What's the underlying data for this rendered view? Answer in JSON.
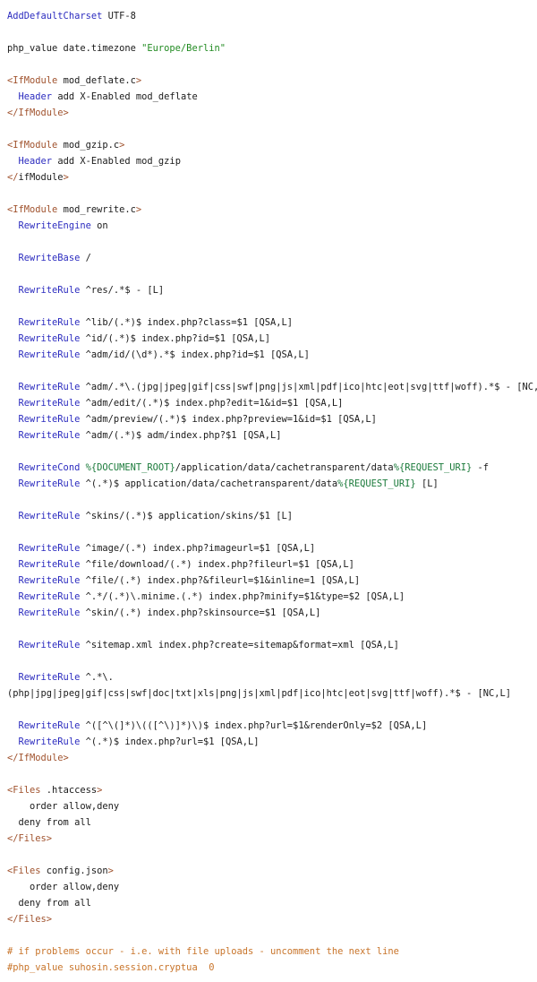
{
  "colors": {
    "keyword": "#2b2bbf",
    "string": "#228b22",
    "tag": "#a0522d",
    "variable": "#1a7a3a",
    "comment": "#c8742a",
    "text": "#1a1a1a",
    "background": "#ffffff"
  },
  "lines": [
    [
      {
        "t": "k",
        "v": "AddDefaultCharset"
      },
      {
        "t": "p",
        "v": " UTF-8"
      }
    ],
    [],
    [
      {
        "t": "p",
        "v": "php_value date.timezone "
      },
      {
        "t": "s",
        "v": "\"Europe/Berlin\""
      }
    ],
    [],
    [
      {
        "t": "t",
        "v": "<IfModule"
      },
      {
        "t": "p",
        "v": " mod_deflate.c"
      },
      {
        "t": "t",
        "v": ">"
      }
    ],
    [
      {
        "t": "p",
        "v": "  "
      },
      {
        "t": "k",
        "v": "Header"
      },
      {
        "t": "p",
        "v": " add X-Enabled mod_deflate"
      }
    ],
    [
      {
        "t": "t",
        "v": "</IfModule>"
      }
    ],
    [],
    [
      {
        "t": "t",
        "v": "<IfModule"
      },
      {
        "t": "p",
        "v": " mod_gzip.c"
      },
      {
        "t": "t",
        "v": ">"
      }
    ],
    [
      {
        "t": "p",
        "v": "  "
      },
      {
        "t": "k",
        "v": "Header"
      },
      {
        "t": "p",
        "v": " add X-Enabled mod_gzip"
      }
    ],
    [
      {
        "t": "t",
        "v": "</"
      },
      {
        "t": "p",
        "v": "ifModule"
      },
      {
        "t": "t",
        "v": ">"
      }
    ],
    [],
    [
      {
        "t": "t",
        "v": "<IfModule"
      },
      {
        "t": "p",
        "v": " mod_rewrite.c"
      },
      {
        "t": "t",
        "v": ">"
      }
    ],
    [
      {
        "t": "p",
        "v": "  "
      },
      {
        "t": "k",
        "v": "RewriteEngine"
      },
      {
        "t": "p",
        "v": " on"
      }
    ],
    [],
    [
      {
        "t": "p",
        "v": "  "
      },
      {
        "t": "k",
        "v": "RewriteBase"
      },
      {
        "t": "p",
        "v": " /"
      }
    ],
    [],
    [
      {
        "t": "p",
        "v": "  "
      },
      {
        "t": "k",
        "v": "RewriteRule"
      },
      {
        "t": "p",
        "v": " ^res/.*$ - [L]"
      }
    ],
    [],
    [
      {
        "t": "p",
        "v": "  "
      },
      {
        "t": "k",
        "v": "RewriteRule"
      },
      {
        "t": "p",
        "v": " ^lib/(.*)$ index.php?class=$1 [QSA,L]"
      }
    ],
    [
      {
        "t": "p",
        "v": "  "
      },
      {
        "t": "k",
        "v": "RewriteRule"
      },
      {
        "t": "p",
        "v": " ^id/(.*)$ index.php?id=$1 [QSA,L]"
      }
    ],
    [
      {
        "t": "p",
        "v": "  "
      },
      {
        "t": "k",
        "v": "RewriteRule"
      },
      {
        "t": "p",
        "v": " ^adm/id/(\\d*).*$ index.php?id=$1 [QSA,L]"
      }
    ],
    [],
    [
      {
        "t": "p",
        "v": "  "
      },
      {
        "t": "k",
        "v": "RewriteRule"
      },
      {
        "t": "p",
        "v": " ^adm/.*\\.(jpg|jpeg|gif|css|swf|png|js|xml|pdf|ico|htc|eot|svg|ttf|woff).*$ - [NC,L]"
      }
    ],
    [
      {
        "t": "p",
        "v": "  "
      },
      {
        "t": "k",
        "v": "RewriteRule"
      },
      {
        "t": "p",
        "v": " ^adm/edit/(.*)$ index.php?edit=1&id=$1 [QSA,L]"
      }
    ],
    [
      {
        "t": "p",
        "v": "  "
      },
      {
        "t": "k",
        "v": "RewriteRule"
      },
      {
        "t": "p",
        "v": " ^adm/preview/(.*)$ index.php?preview=1&id=$1 [QSA,L]"
      }
    ],
    [
      {
        "t": "p",
        "v": "  "
      },
      {
        "t": "k",
        "v": "RewriteRule"
      },
      {
        "t": "p",
        "v": " ^adm/(.*)$ adm/index.php?$1 [QSA,L]"
      }
    ],
    [],
    [
      {
        "t": "p",
        "v": "  "
      },
      {
        "t": "k",
        "v": "RewriteCond"
      },
      {
        "t": "p",
        "v": " "
      },
      {
        "t": "v",
        "v": "%{DOCUMENT_ROOT}"
      },
      {
        "t": "p",
        "v": "/application/data/cachetransparent/data"
      },
      {
        "t": "v",
        "v": "%{REQUEST_URI}"
      },
      {
        "t": "p",
        "v": " -f"
      }
    ],
    [
      {
        "t": "p",
        "v": "  "
      },
      {
        "t": "k",
        "v": "RewriteRule"
      },
      {
        "t": "p",
        "v": " ^(.*)$ application/data/cachetransparent/data"
      },
      {
        "t": "v",
        "v": "%{REQUEST_URI}"
      },
      {
        "t": "p",
        "v": " [L]"
      }
    ],
    [],
    [
      {
        "t": "p",
        "v": "  "
      },
      {
        "t": "k",
        "v": "RewriteRule"
      },
      {
        "t": "p",
        "v": " ^skins/(.*)$ application/skins/$1 [L]"
      }
    ],
    [],
    [
      {
        "t": "p",
        "v": "  "
      },
      {
        "t": "k",
        "v": "RewriteRule"
      },
      {
        "t": "p",
        "v": " ^image/(.*) index.php?imageurl=$1 [QSA,L]"
      }
    ],
    [
      {
        "t": "p",
        "v": "  "
      },
      {
        "t": "k",
        "v": "RewriteRule"
      },
      {
        "t": "p",
        "v": " ^file/download/(.*) index.php?fileurl=$1 [QSA,L]"
      }
    ],
    [
      {
        "t": "p",
        "v": "  "
      },
      {
        "t": "k",
        "v": "RewriteRule"
      },
      {
        "t": "p",
        "v": " ^file/(.*) index.php?&fileurl=$1&inline=1 [QSA,L]"
      }
    ],
    [
      {
        "t": "p",
        "v": "  "
      },
      {
        "t": "k",
        "v": "RewriteRule"
      },
      {
        "t": "p",
        "v": " ^.*/(.*)\\.minime.(.*) index.php?minify=$1&type=$2 [QSA,L]"
      }
    ],
    [
      {
        "t": "p",
        "v": "  "
      },
      {
        "t": "k",
        "v": "RewriteRule"
      },
      {
        "t": "p",
        "v": " ^skin/(.*) index.php?skinsource=$1 [QSA,L]"
      }
    ],
    [],
    [
      {
        "t": "p",
        "v": "  "
      },
      {
        "t": "k",
        "v": "RewriteRule"
      },
      {
        "t": "p",
        "v": " ^sitemap.xml index.php?create=sitemap&format=xml [QSA,L]"
      }
    ],
    [],
    [
      {
        "t": "p",
        "v": "  "
      },
      {
        "t": "k",
        "v": "RewriteRule"
      },
      {
        "t": "p",
        "v": " ^.*\\."
      }
    ],
    [
      {
        "t": "p",
        "v": "(php|jpg|jpeg|gif|css|swf|doc|txt|xls|png|js|xml|pdf|ico|htc|eot|svg|ttf|woff).*$ - [NC,L]"
      }
    ],
    [],
    [
      {
        "t": "p",
        "v": "  "
      },
      {
        "t": "k",
        "v": "RewriteRule"
      },
      {
        "t": "p",
        "v": " ^([^\\(]*)\\(([^\\)]*)\\)$ index.php?url=$1&renderOnly=$2 [QSA,L]"
      }
    ],
    [
      {
        "t": "p",
        "v": "  "
      },
      {
        "t": "k",
        "v": "RewriteRule"
      },
      {
        "t": "p",
        "v": " ^(.*)$ index.php?url=$1 [QSA,L]"
      }
    ],
    [
      {
        "t": "t",
        "v": "</IfModule>"
      }
    ],
    [],
    [
      {
        "t": "t",
        "v": "<Files"
      },
      {
        "t": "p",
        "v": " .htaccess"
      },
      {
        "t": "t",
        "v": ">"
      }
    ],
    [
      {
        "t": "p",
        "v": "    order allow,deny"
      }
    ],
    [
      {
        "t": "p",
        "v": "  deny from all"
      }
    ],
    [
      {
        "t": "t",
        "v": "</Files>"
      }
    ],
    [],
    [
      {
        "t": "t",
        "v": "<Files"
      },
      {
        "t": "p",
        "v": " config.json"
      },
      {
        "t": "t",
        "v": ">"
      }
    ],
    [
      {
        "t": "p",
        "v": "    order allow,deny"
      }
    ],
    [
      {
        "t": "p",
        "v": "  deny from all"
      }
    ],
    [
      {
        "t": "t",
        "v": "</Files>"
      }
    ],
    [],
    [
      {
        "t": "c",
        "v": "# if problems occur - i.e. with file uploads - uncomment the next line"
      }
    ],
    [
      {
        "t": "c",
        "v": "#php_value suhosin.session.cryptua  0"
      }
    ]
  ]
}
